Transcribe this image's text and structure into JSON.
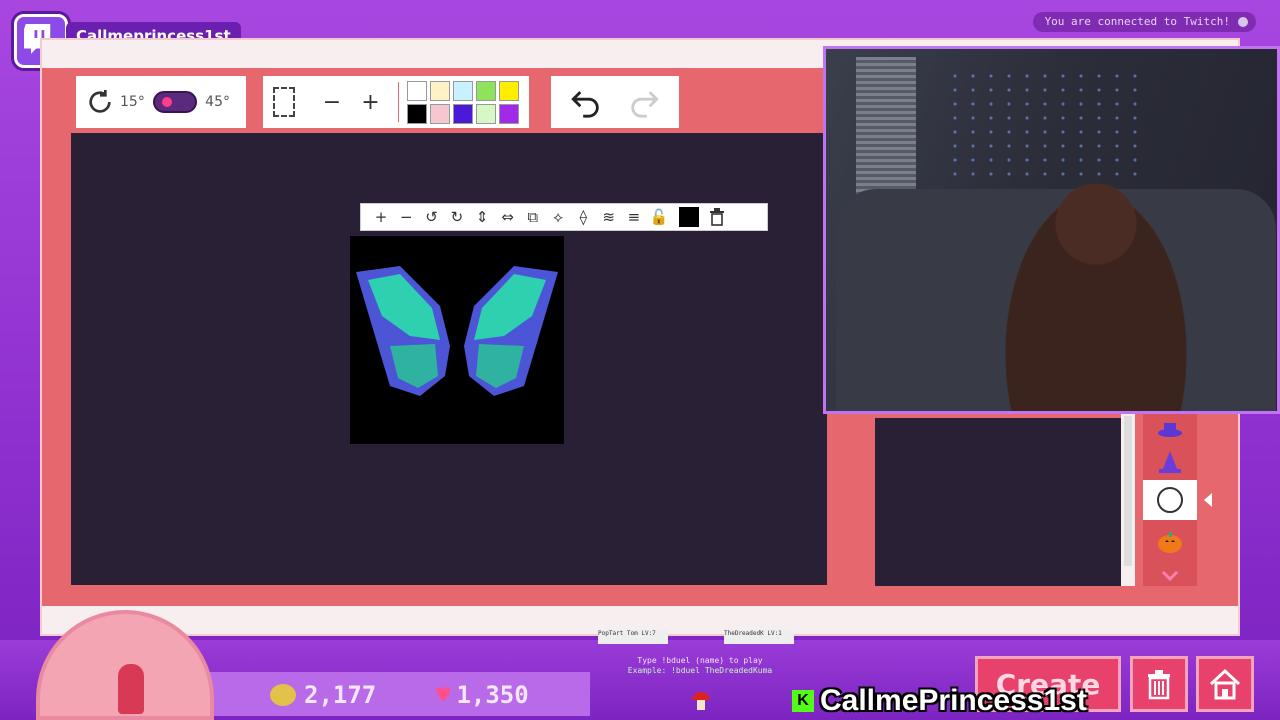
{
  "channel": {
    "name": "Callmeprincess1st"
  },
  "twitch_status": "You are connected to Twitch!",
  "rotation": {
    "step_small": "15°",
    "step_large": "45°"
  },
  "selection": {
    "minus": "−",
    "plus": "+"
  },
  "palette": [
    "#ffffff",
    "#fff2c4",
    "#c9f1ff",
    "#8ee35a",
    "#ffee00",
    "#000000",
    "#f6c7cf",
    "#4a1ad6",
    "#d7f7c4",
    "#a02ae8"
  ],
  "object_toolbar": {
    "items": [
      "+",
      "−",
      "↺",
      "↻",
      "⇕",
      "⇔",
      "⧉",
      "⟡",
      "⟠",
      "≋",
      "≡",
      "🔓"
    ],
    "color": "#000000"
  },
  "colors": {
    "accent": "#e6676d",
    "frame": "#9c3fd6",
    "canvas": "#2a2036"
  },
  "hud": {
    "coins": "2,177",
    "hearts": "1,350",
    "duel_players": [
      "PopTart Tom  LV:7",
      "TheDreadedK  LV:1"
    ],
    "duel_prompt": "Type !bduel (name) to play",
    "duel_example": "Example: !bduel TheDreadedKuma",
    "create_label": "Create"
  },
  "overlay_name": "CallmePrincess1st",
  "overlay_badge": "K"
}
